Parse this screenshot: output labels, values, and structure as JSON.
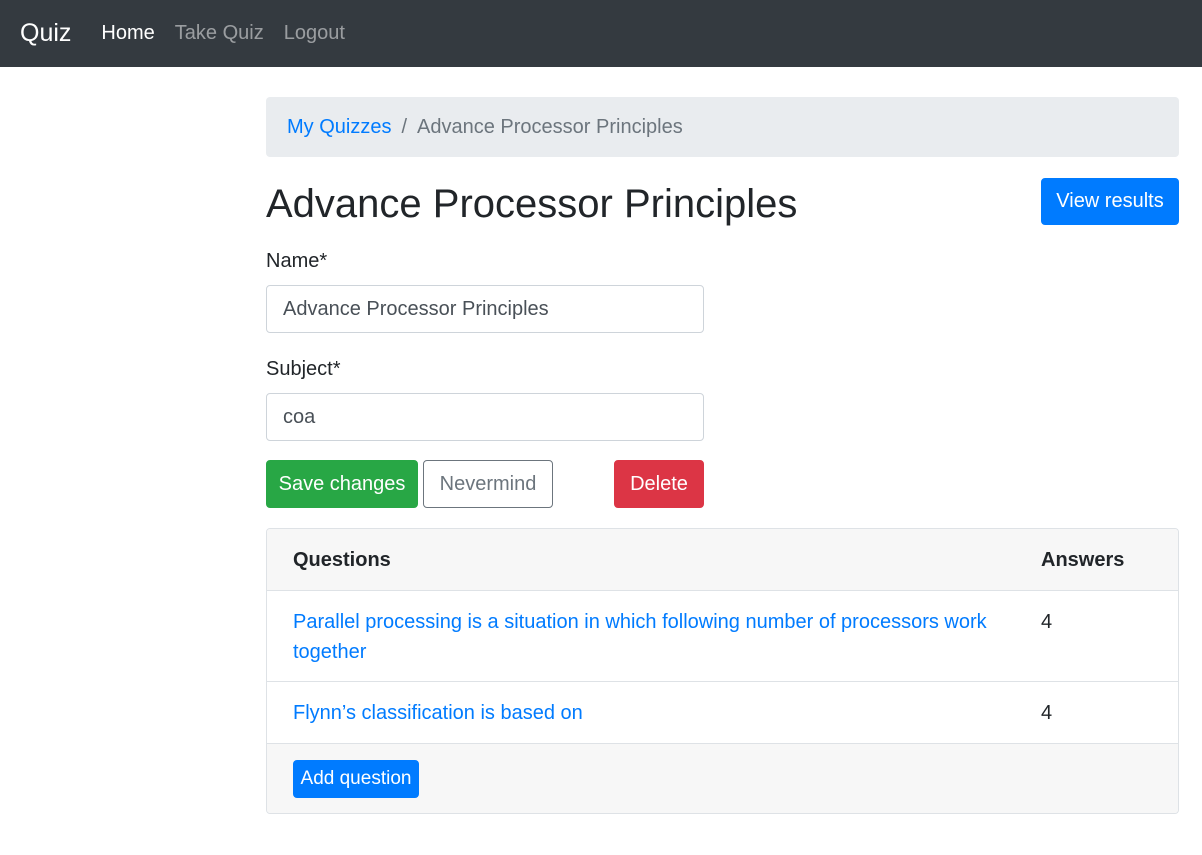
{
  "navbar": {
    "brand": "Quiz",
    "links": [
      {
        "label": "Home",
        "active": true
      },
      {
        "label": "Take Quiz",
        "active": false
      },
      {
        "label": "Logout",
        "active": false
      }
    ]
  },
  "breadcrumb": {
    "parent": "My Quizzes",
    "separator": "/",
    "current": "Advance Processor Principles"
  },
  "page": {
    "title": "Advance Processor Principles",
    "view_results_label": "View results"
  },
  "form": {
    "name_label": "Name*",
    "name_value": "Advance Processor Principles",
    "subject_label": "Subject*",
    "subject_value": "coa",
    "save_label": "Save changes",
    "nevermind_label": "Nevermind",
    "delete_label": "Delete"
  },
  "questions_table": {
    "headers": {
      "questions": "Questions",
      "answers": "Answers"
    },
    "rows": [
      {
        "question": "Parallel processing is a situation in which following number of processors work together",
        "answers": "4"
      },
      {
        "question": "Flynn’s classification is based on",
        "answers": "4"
      }
    ],
    "add_question_label": "Add question"
  },
  "colors": {
    "navbar_bg": "#343a40",
    "primary": "#007bff",
    "success": "#28a745",
    "danger": "#dc3545",
    "secondary": "#6c757d"
  }
}
